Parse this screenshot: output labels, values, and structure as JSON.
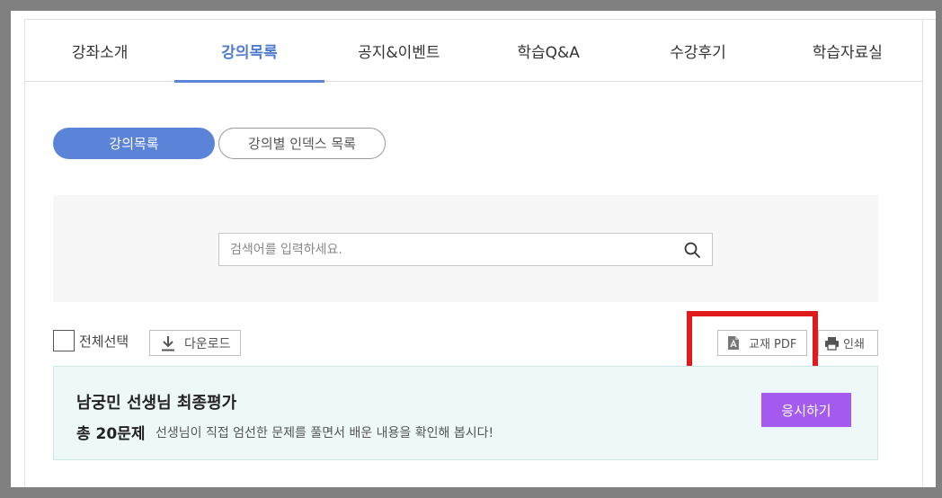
{
  "tabs": [
    {
      "label": "강좌소개",
      "active": false
    },
    {
      "label": "강의목록",
      "active": true
    },
    {
      "label": "공지&이벤트",
      "active": false
    },
    {
      "label": "학습Q&A",
      "active": false
    },
    {
      "label": "수강후기",
      "active": false
    },
    {
      "label": "학습자료실",
      "active": false
    }
  ],
  "subtabs": {
    "lecture_list": "강의목록",
    "index_list": "강의별 인덱스 목록"
  },
  "search": {
    "placeholder": "검색어를 입력하세요.",
    "value": ""
  },
  "toolbar": {
    "select_all": "전체선택",
    "download": "다운로드",
    "textbook_pdf": "교재 PDF",
    "print": "인쇄"
  },
  "exam": {
    "title": "남궁민 선생님 최종평가",
    "count": "총 20문제",
    "description": "선생님이 직접 엄선한 문제를 풀면서 배운 내용을 확인해 봅시다!",
    "button": "응시하기"
  },
  "colors": {
    "accent": "#5b84d8",
    "exam_button": "#a55bf0",
    "highlight": "#e01b1b"
  }
}
